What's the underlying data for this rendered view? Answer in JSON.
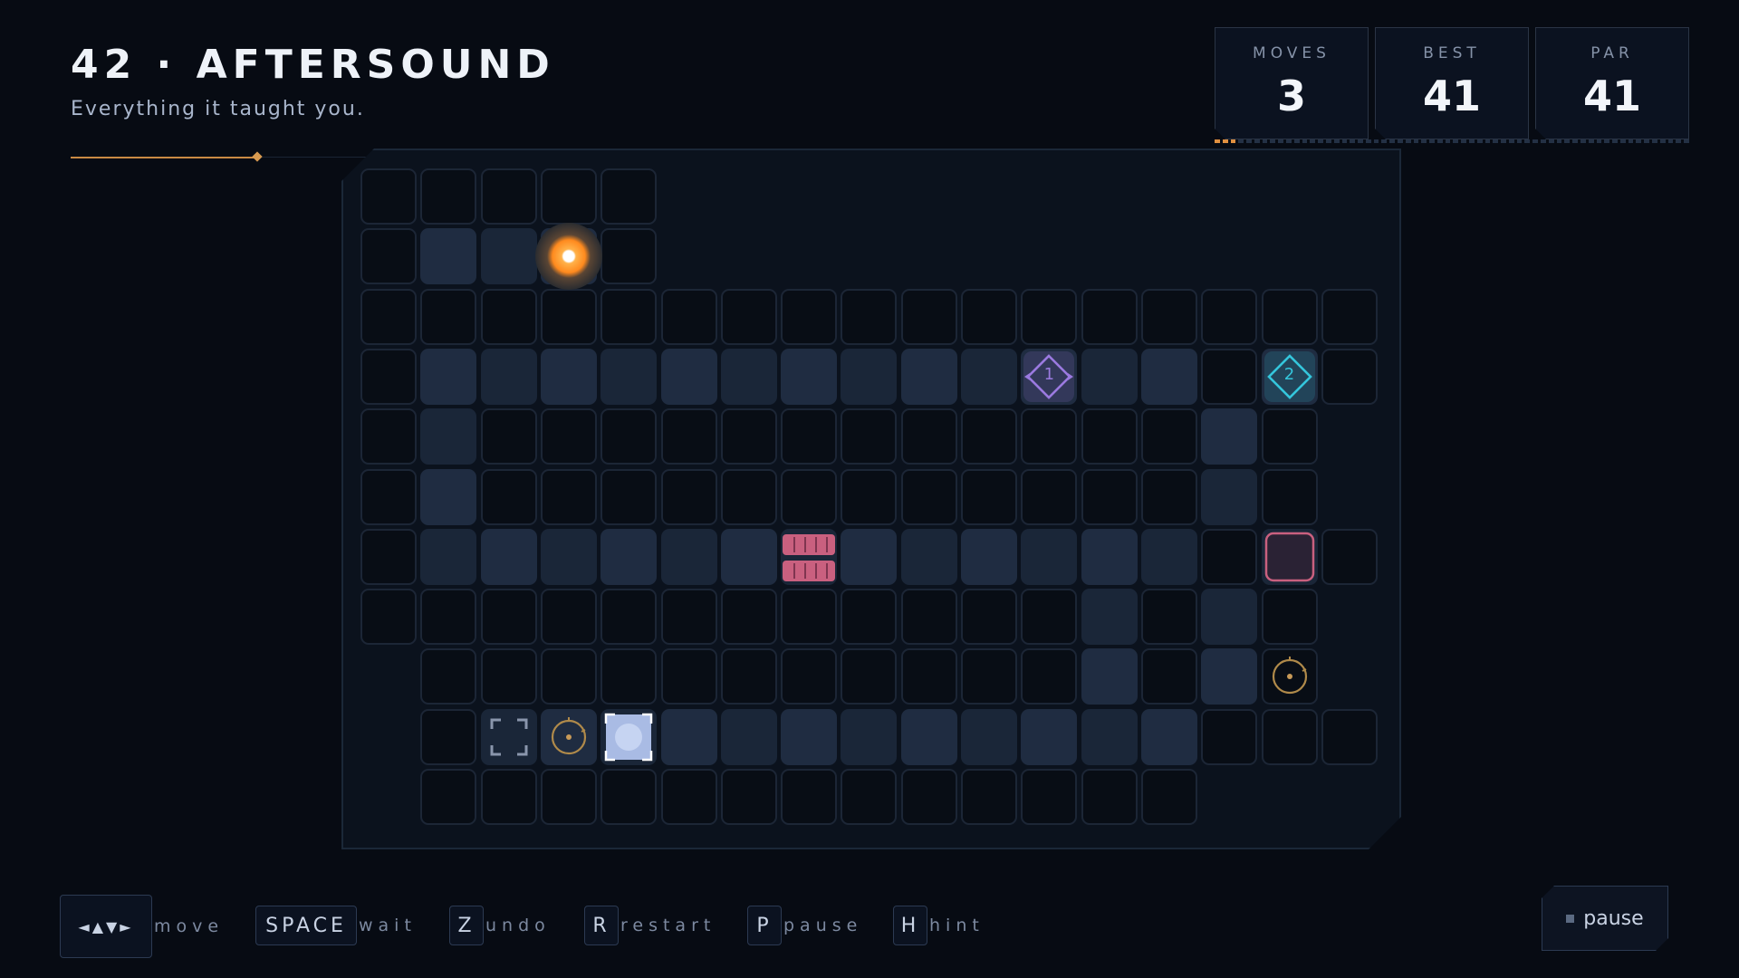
{
  "level": {
    "title": "42 · AFTERSOUND",
    "subtitle": "Everything it taught you."
  },
  "progress": {
    "fraction": 0.17
  },
  "stats": [
    {
      "label": "MOVES",
      "value": "3"
    },
    {
      "label": "BEST",
      "value": "41"
    },
    {
      "label": "PAR",
      "value": "41"
    }
  ],
  "moves_tick_total": 60,
  "moves_used": 3,
  "board": {
    "cols": 17,
    "rows": 11,
    "cells": [
      ".....",
      ".PP#.",
      ".................",
      ".PPPPPPPPPPAPP.B.",
      ".P............P.",
      ".P............P.",
      ".PPPPPPGPPPPPP.R.",
      "............P.P.",
      " ...........P.T.",
      " .CTBPPPPPPPPP...",
      " ............."
    ],
    "player": {
      "row": 1,
      "col": 3
    },
    "nodes": [
      {
        "row": 3,
        "col": 11,
        "kind": "resonator",
        "label": "1",
        "color": "#9b7ae0"
      },
      {
        "row": 3,
        "col": 15,
        "kind": "resonator",
        "label": "2",
        "color": "#34c6dc"
      }
    ],
    "gate": {
      "row": 6,
      "col": 7,
      "color": "#c9607f"
    },
    "switch": {
      "row": 6,
      "col": 15,
      "color": "#c9607f"
    },
    "targets": [
      {
        "row": 8,
        "col": 15
      },
      {
        "row": 9,
        "col": 3
      }
    ],
    "exit": {
      "row": 9,
      "col": 2
    },
    "box": {
      "row": 9,
      "col": 4
    }
  },
  "controls": [
    {
      "key": "◄▲▼►",
      "action": "move"
    },
    {
      "key": "SPACE",
      "action": "wait"
    },
    {
      "key": "Z",
      "action": "undo"
    },
    {
      "key": "R",
      "action": "restart"
    },
    {
      "key": "P",
      "action": "pause"
    },
    {
      "key": "H",
      "action": "hint"
    }
  ],
  "pause_button": {
    "label": "pause"
  },
  "colors": {
    "accent": "#e09040",
    "path": "#1f2c41",
    "empty_border": "#1c2636"
  }
}
